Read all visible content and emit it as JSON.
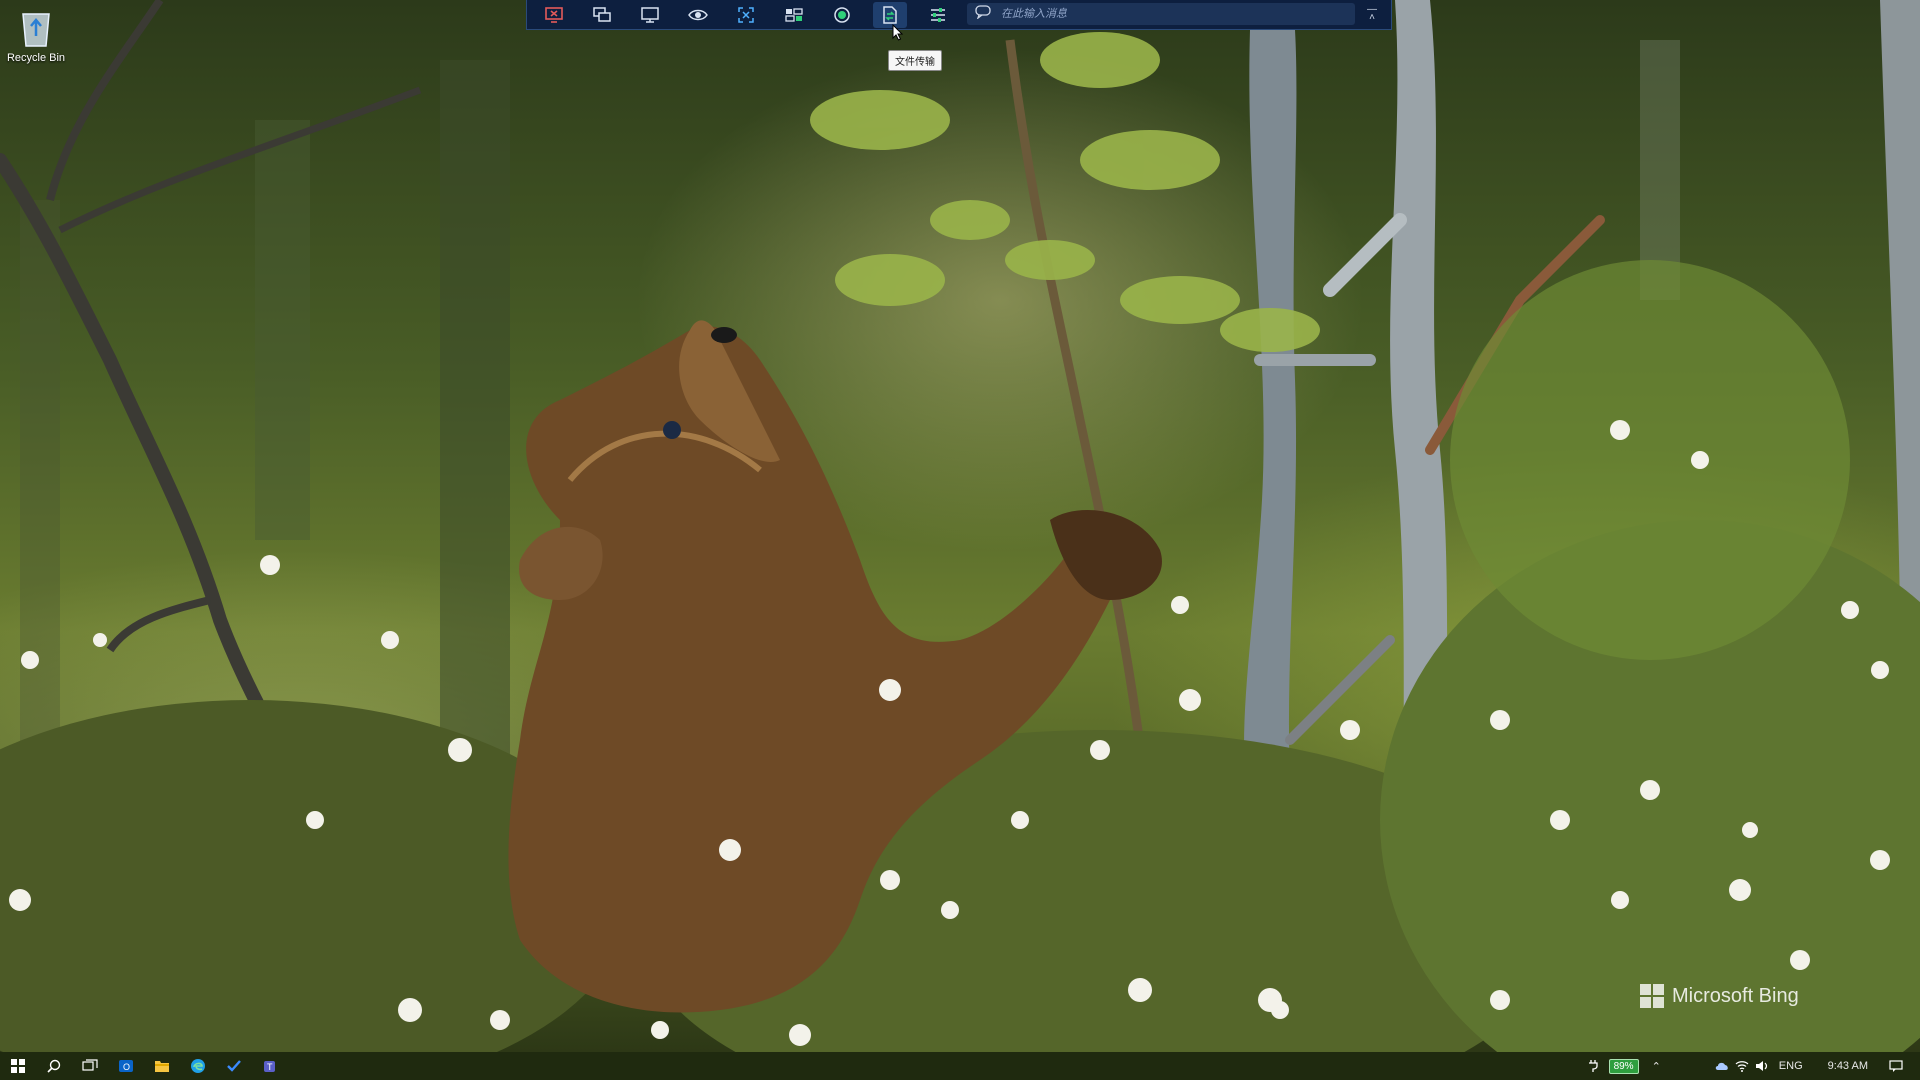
{
  "desktop": {
    "icons": [
      {
        "label": "Recycle Bin",
        "icon": "recycle-bin-icon"
      }
    ]
  },
  "remote_toolbar": {
    "buttons": [
      {
        "icon": "disconnect-monitor-icon"
      },
      {
        "icon": "switch-screens-icon"
      },
      {
        "icon": "display-icon"
      },
      {
        "icon": "view-mode-icon"
      },
      {
        "icon": "fit-screen-icon"
      },
      {
        "icon": "keyboard-actions-icon"
      },
      {
        "icon": "record-icon"
      },
      {
        "icon": "file-transfer-icon",
        "active": true
      },
      {
        "icon": "settings-sliders-icon"
      }
    ],
    "search": {
      "icon": "chat-icon",
      "placeholder": "在此输入消息"
    },
    "collapse_icon": "collapse-arrows-icon",
    "tooltip": "文件传输"
  },
  "watermark": {
    "text": "Microsoft Bing"
  },
  "taskbar": {
    "apps": [
      {
        "icon": "start-windows-icon"
      },
      {
        "icon": "search-icon"
      },
      {
        "icon": "task-view-icon"
      },
      {
        "icon": "outlook-icon"
      },
      {
        "icon": "file-explorer-icon"
      },
      {
        "icon": "edge-icon"
      },
      {
        "icon": "todo-check-icon"
      },
      {
        "icon": "teams-icon"
      }
    ],
    "tray": {
      "battery": "89%",
      "language": "ENG",
      "time": "9:43 AM"
    }
  },
  "colors": {
    "toolbar_bg": "#0d1f3f",
    "battery": "#2e9e3e",
    "taskbar": "#1f2a0f"
  }
}
